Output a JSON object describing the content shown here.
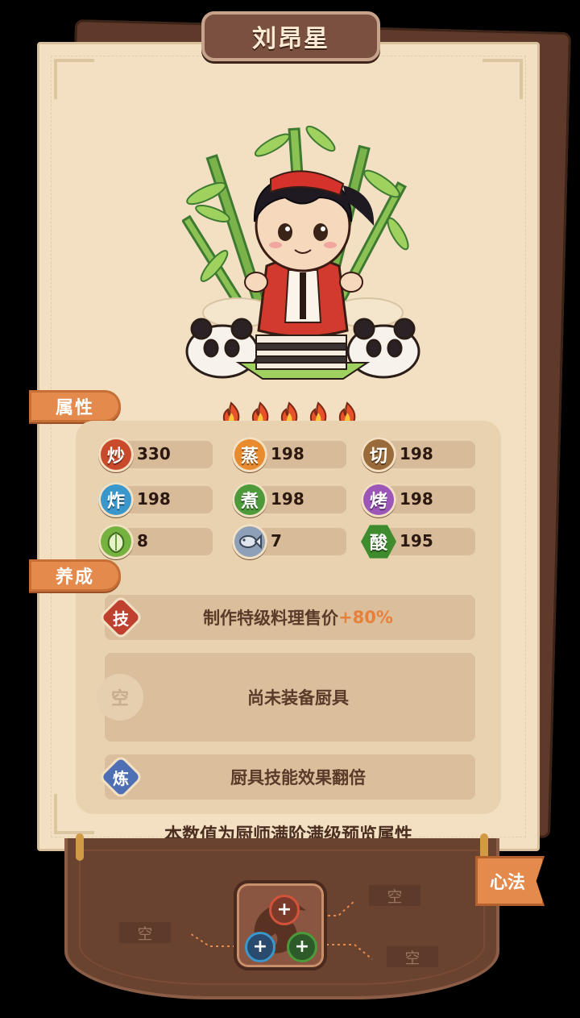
{
  "chef_name": "刘昂星",
  "rarity_stars": 5,
  "tabs": {
    "attributes": "属性",
    "cultivation": "养成",
    "heart_method": "心法"
  },
  "stats": [
    {
      "key": "stir_fry",
      "label": "炒",
      "value": "330",
      "color": "#c94a2b"
    },
    {
      "key": "steam",
      "label": "蒸",
      "value": "198",
      "color": "#e88a2e"
    },
    {
      "key": "cut",
      "label": "切",
      "value": "198",
      "color": "#9a6b3a"
    },
    {
      "key": "deep_fry",
      "label": "炸",
      "value": "198",
      "color": "#3a97cc"
    },
    {
      "key": "boil",
      "label": "煮",
      "value": "198",
      "color": "#4c9a3a"
    },
    {
      "key": "bake",
      "label": "烤",
      "value": "198",
      "color": "#9c56b8"
    },
    {
      "key": "vegetable",
      "label": "",
      "value": "8",
      "color": "#76b23f"
    },
    {
      "key": "fish",
      "label": "",
      "value": "7",
      "color": "#8da0b8"
    },
    {
      "key": "sour",
      "label": "酸",
      "value": "195",
      "color": "#3f8c2f"
    }
  ],
  "skills": {
    "skill_icon": "技",
    "skill_text": "制作特级料理售价",
    "skill_bonus": "+80%",
    "equipment_icon": "空",
    "equipment_text": "尚未装备厨具",
    "refine_icon": "炼",
    "refine_text": "厨具技能效果翻倍"
  },
  "preview_note": "本数值为厨师满阶满级预览属性",
  "heart_slots": {
    "empty_label": "空"
  },
  "colors": {
    "paper": "#f3e0c3",
    "accent": "#e48a4d",
    "wood": "#6a4230"
  }
}
